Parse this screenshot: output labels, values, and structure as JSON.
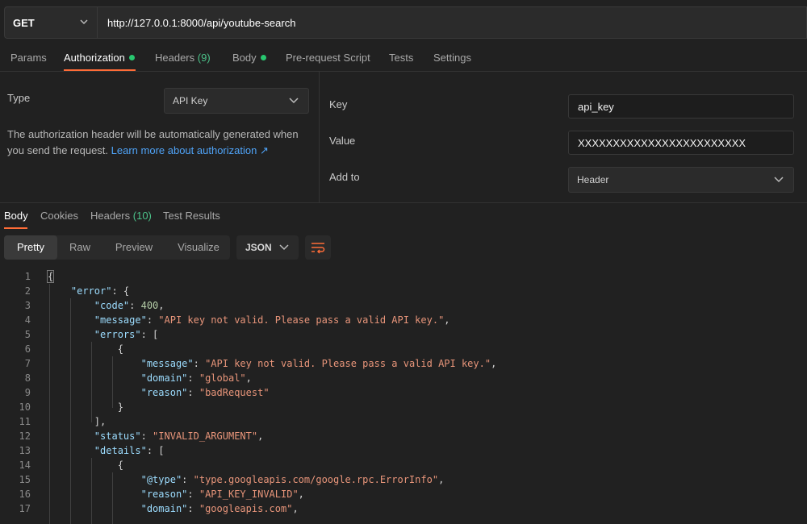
{
  "request": {
    "method": "GET",
    "url": "http://127.0.0.1:8000/api/youtube-search"
  },
  "request_tabs": {
    "params": "Params",
    "authorization": "Authorization",
    "headers": "Headers",
    "headers_count": "(9)",
    "body": "Body",
    "prerequest": "Pre-request Script",
    "tests": "Tests",
    "settings": "Settings"
  },
  "auth": {
    "type_label": "Type",
    "type_value": "API Key",
    "description": "The authorization header will be automatically generated when you send the request. ",
    "learn_more": "Learn more about authorization ↗",
    "key_label": "Key",
    "key_value": "api_key",
    "value_label": "Value",
    "value_value": "XXXXXXXXXXXXXXXXXXXXXXXX",
    "add_to_label": "Add to",
    "add_to_value": "Header"
  },
  "response_tabs": {
    "body": "Body",
    "cookies": "Cookies",
    "headers": "Headers",
    "headers_count": "(10)",
    "test_results": "Test Results"
  },
  "view_modes": {
    "pretty": "Pretty",
    "raw": "Raw",
    "preview": "Preview",
    "visualize": "Visualize"
  },
  "format": "JSON",
  "colors": {
    "accent": "#ff6c37",
    "status_dot": "#28c76f",
    "key": "#9cdcfe",
    "string": "#e8957a",
    "number": "#b5cea8",
    "link": "#4fa3f7"
  },
  "code_lines": [
    {
      "n": "1",
      "parts": [
        {
          "t": "{",
          "c": "p"
        }
      ]
    },
    {
      "n": "2",
      "parts": [
        {
          "t": "    ",
          "c": "p"
        },
        {
          "t": "\"error\"",
          "c": "k"
        },
        {
          "t": ": {",
          "c": "p"
        }
      ]
    },
    {
      "n": "3",
      "parts": [
        {
          "t": "        ",
          "c": "p"
        },
        {
          "t": "\"code\"",
          "c": "k"
        },
        {
          "t": ": ",
          "c": "p"
        },
        {
          "t": "400",
          "c": "n"
        },
        {
          "t": ",",
          "c": "p"
        }
      ]
    },
    {
      "n": "4",
      "parts": [
        {
          "t": "        ",
          "c": "p"
        },
        {
          "t": "\"message\"",
          "c": "k"
        },
        {
          "t": ": ",
          "c": "p"
        },
        {
          "t": "\"API key not valid. Please pass a valid API key.\"",
          "c": "s"
        },
        {
          "t": ",",
          "c": "p"
        }
      ]
    },
    {
      "n": "5",
      "parts": [
        {
          "t": "        ",
          "c": "p"
        },
        {
          "t": "\"errors\"",
          "c": "k"
        },
        {
          "t": ": [",
          "c": "p"
        }
      ]
    },
    {
      "n": "6",
      "parts": [
        {
          "t": "            {",
          "c": "p"
        }
      ]
    },
    {
      "n": "7",
      "parts": [
        {
          "t": "                ",
          "c": "p"
        },
        {
          "t": "\"message\"",
          "c": "k"
        },
        {
          "t": ": ",
          "c": "p"
        },
        {
          "t": "\"API key not valid. Please pass a valid API key.\"",
          "c": "s"
        },
        {
          "t": ",",
          "c": "p"
        }
      ]
    },
    {
      "n": "8",
      "parts": [
        {
          "t": "                ",
          "c": "p"
        },
        {
          "t": "\"domain\"",
          "c": "k"
        },
        {
          "t": ": ",
          "c": "p"
        },
        {
          "t": "\"global\"",
          "c": "s"
        },
        {
          "t": ",",
          "c": "p"
        }
      ]
    },
    {
      "n": "9",
      "parts": [
        {
          "t": "                ",
          "c": "p"
        },
        {
          "t": "\"reason\"",
          "c": "k"
        },
        {
          "t": ": ",
          "c": "p"
        },
        {
          "t": "\"badRequest\"",
          "c": "s"
        }
      ]
    },
    {
      "n": "10",
      "parts": [
        {
          "t": "            }",
          "c": "p"
        }
      ]
    },
    {
      "n": "11",
      "parts": [
        {
          "t": "        ],",
          "c": "p"
        }
      ]
    },
    {
      "n": "12",
      "parts": [
        {
          "t": "        ",
          "c": "p"
        },
        {
          "t": "\"status\"",
          "c": "k"
        },
        {
          "t": ": ",
          "c": "p"
        },
        {
          "t": "\"INVALID_ARGUMENT\"",
          "c": "s"
        },
        {
          "t": ",",
          "c": "p"
        }
      ]
    },
    {
      "n": "13",
      "parts": [
        {
          "t": "        ",
          "c": "p"
        },
        {
          "t": "\"details\"",
          "c": "k"
        },
        {
          "t": ": [",
          "c": "p"
        }
      ]
    },
    {
      "n": "14",
      "parts": [
        {
          "t": "            {",
          "c": "p"
        }
      ]
    },
    {
      "n": "15",
      "parts": [
        {
          "t": "                ",
          "c": "p"
        },
        {
          "t": "\"@type\"",
          "c": "k"
        },
        {
          "t": ": ",
          "c": "p"
        },
        {
          "t": "\"type.googleapis.com/google.rpc.ErrorInfo\"",
          "c": "s"
        },
        {
          "t": ",",
          "c": "p"
        }
      ]
    },
    {
      "n": "16",
      "parts": [
        {
          "t": "                ",
          "c": "p"
        },
        {
          "t": "\"reason\"",
          "c": "k"
        },
        {
          "t": ": ",
          "c": "p"
        },
        {
          "t": "\"API_KEY_INVALID\"",
          "c": "s"
        },
        {
          "t": ",",
          "c": "p"
        }
      ]
    },
    {
      "n": "17",
      "parts": [
        {
          "t": "                ",
          "c": "p"
        },
        {
          "t": "\"domain\"",
          "c": "k"
        },
        {
          "t": ": ",
          "c": "p"
        },
        {
          "t": "\"googleapis.com\"",
          "c": "s"
        },
        {
          "t": ",",
          "c": "p"
        }
      ]
    }
  ]
}
